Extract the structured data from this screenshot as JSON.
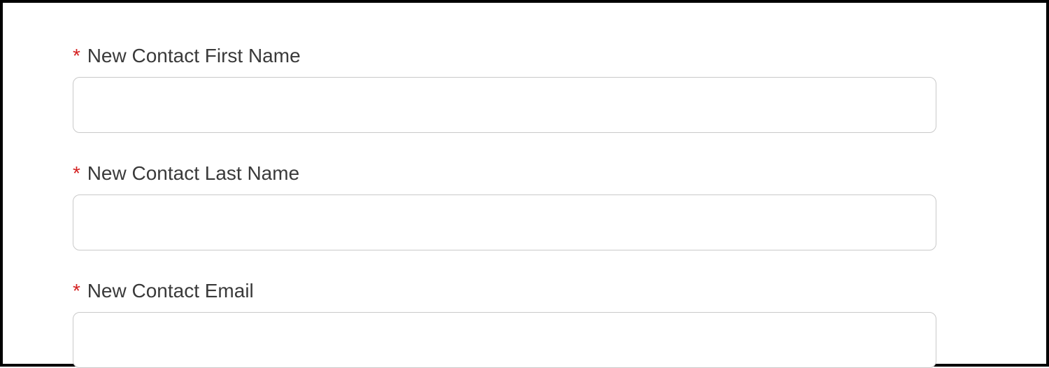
{
  "form": {
    "required_marker": "*",
    "fields": {
      "first_name": {
        "label": "New Contact First Name",
        "value": ""
      },
      "last_name": {
        "label": "New Contact Last Name",
        "value": ""
      },
      "email": {
        "label": "New Contact Email",
        "value": ""
      }
    }
  }
}
